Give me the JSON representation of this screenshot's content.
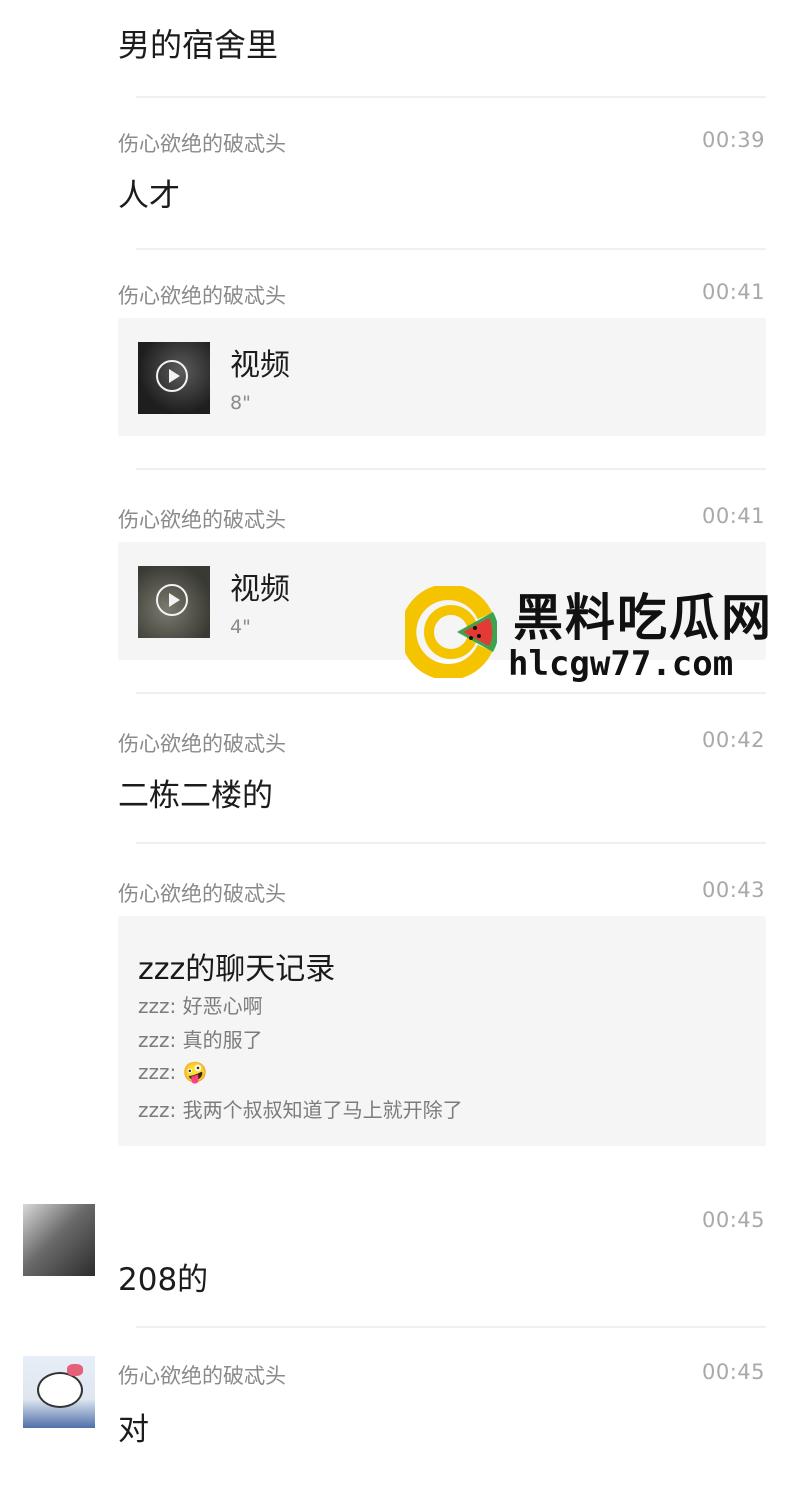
{
  "chat": {
    "title": "男的宿舍里",
    "messages": [
      {
        "sender": "伤心欲绝的破忒头",
        "time": "00:39",
        "text": "人才"
      },
      {
        "sender": "伤心欲绝的破忒头",
        "time": "00:41",
        "video_label": "视频",
        "duration": "8\""
      },
      {
        "sender": "伤心欲绝的破忒头",
        "time": "00:41",
        "video_label": "视频",
        "duration": "4\""
      },
      {
        "sender": "伤心欲绝的破忒头",
        "time": "00:42",
        "text": "二栋二楼的"
      },
      {
        "sender": "伤心欲绝的破忒头",
        "time": "00:43",
        "record_title": "zzz的聊天记录",
        "record_lines": [
          "zzz: 好恶心啊",
          "zzz: 真的服了",
          "zzz: 🤪",
          "zzz: 我两个叔叔知道了马上就开除了"
        ]
      },
      {
        "sender": "",
        "time": "00:45",
        "text": "208的"
      },
      {
        "sender": "伤心欲绝的破忒头",
        "time": "00:45",
        "text": "对"
      }
    ]
  },
  "watermark": {
    "title": "黑料吃瓜网",
    "url": "hlcgw77.com",
    "colors": {
      "ring": "#f5c400",
      "melon_green": "#3fa34d",
      "melon_red": "#e53935"
    }
  },
  "icons": [
    "play-icon",
    "watermelon-logo-icon",
    "avatar-photo",
    "avatar-hello-kitty"
  ]
}
